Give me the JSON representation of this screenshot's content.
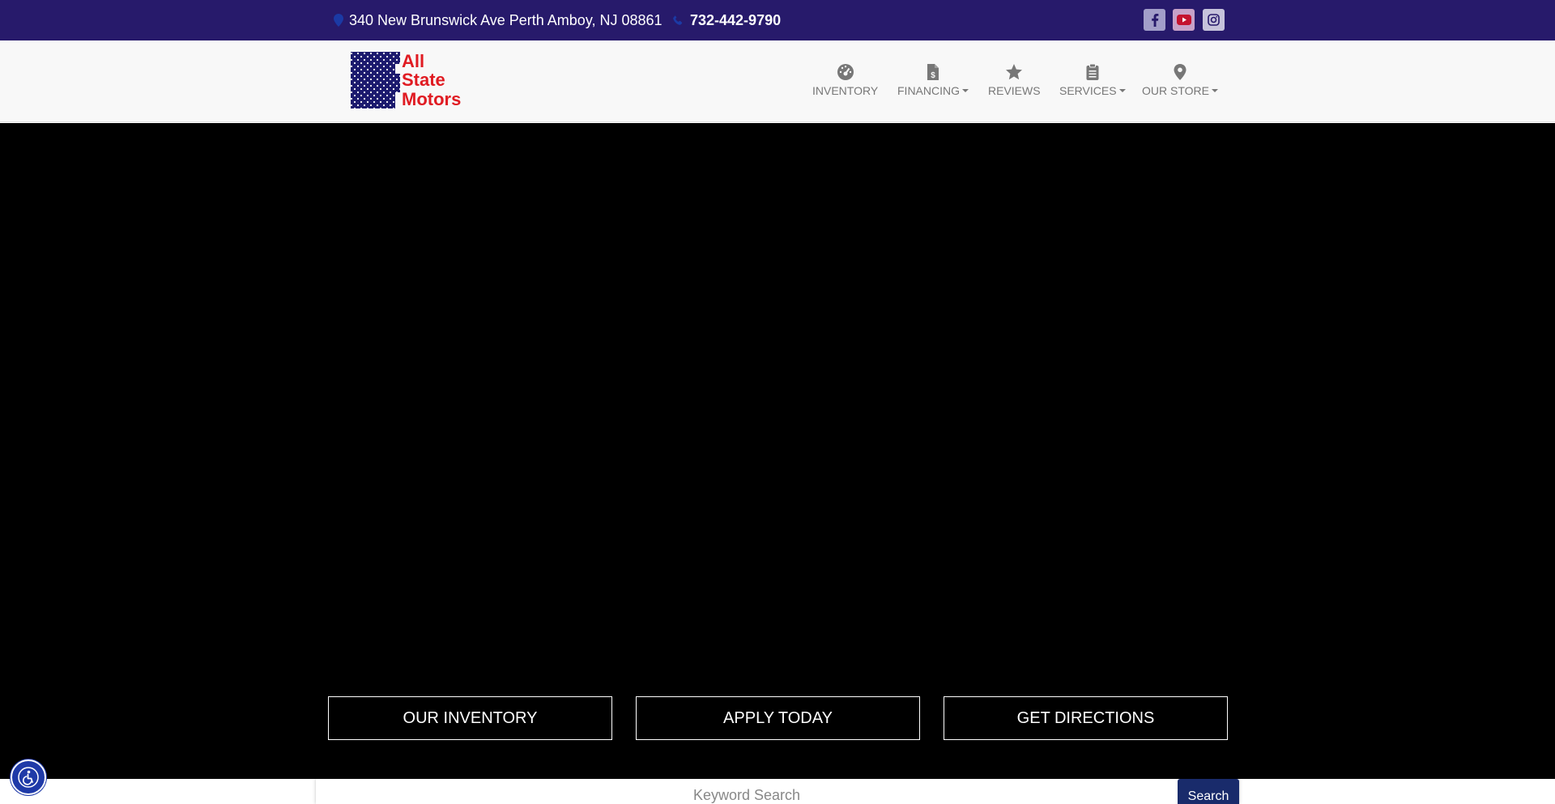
{
  "topbar": {
    "address": "340 New Brunswick Ave Perth Amboy, NJ 08861",
    "phone": "732-442-9790",
    "social": [
      "facebook-icon",
      "youtube-icon",
      "instagram-icon"
    ]
  },
  "logo": {
    "line1": "All",
    "line2": "State",
    "line3": "Motors"
  },
  "nav": [
    {
      "label": "INVENTORY",
      "icon": "dashboard-icon"
    },
    {
      "label": "FINANCING",
      "icon": "dollar-document-icon"
    },
    {
      "label": "REVIEWS",
      "icon": "star-icon"
    },
    {
      "label": "SERVICES",
      "icon": "clipboard-icon"
    },
    {
      "label": "OUR STORE",
      "icon": "map-pin-icon"
    }
  ],
  "cta": {
    "inventory": "OUR INVENTORY",
    "apply": "APPLY TODAY",
    "directions": "GET DIRECTIONS"
  },
  "search": {
    "placeholder": "Keyword Search",
    "button": "Search"
  },
  "colors": {
    "topbar": "#271a6b",
    "logo_red": "#e01b22",
    "logo_blue": "#1c1a6e",
    "search_button": "#192b6b"
  }
}
